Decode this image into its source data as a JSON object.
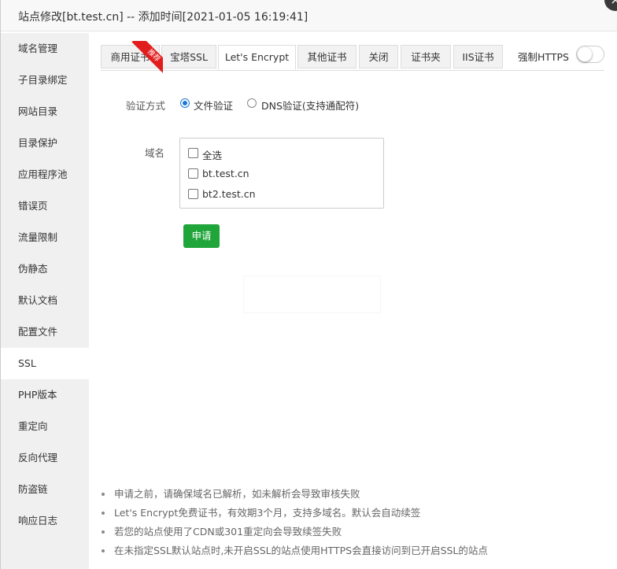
{
  "dialog": {
    "title": "站点修改[bt.test.cn] -- 添加时间[2021-01-05 16:19:41]",
    "close_icon": "close-icon",
    "close_glyph": "×"
  },
  "sidebar": {
    "items": [
      {
        "label": "域名管理"
      },
      {
        "label": "子目录绑定"
      },
      {
        "label": "网站目录"
      },
      {
        "label": "目录保护"
      },
      {
        "label": "应用程序池"
      },
      {
        "label": "错误页"
      },
      {
        "label": "流量限制"
      },
      {
        "label": "伪静态"
      },
      {
        "label": "默认文档"
      },
      {
        "label": "配置文件"
      },
      {
        "label": "SSL",
        "active": true
      },
      {
        "label": "PHP版本"
      },
      {
        "label": "重定向"
      },
      {
        "label": "反向代理"
      },
      {
        "label": "防盗链"
      },
      {
        "label": "响应日志"
      }
    ]
  },
  "tabs": {
    "items": [
      {
        "label": "商用证书"
      },
      {
        "label": "宝塔SSL"
      },
      {
        "label": "Let's Encrypt",
        "active": true
      },
      {
        "label": "其他证书"
      },
      {
        "label": "关闭"
      },
      {
        "label": "证书夹"
      },
      {
        "label": "IIS证书"
      }
    ],
    "ribbon_label": "推荐",
    "ribbon_color": "#e21d1d"
  },
  "force_https": {
    "label": "强制HTTPS",
    "enabled": false
  },
  "form": {
    "verify_label": "验证方式",
    "verify_options": [
      {
        "label": "文件验证",
        "checked": true
      },
      {
        "label": "DNS验证(支持通配符)",
        "checked": false
      }
    ],
    "domain_label": "域名",
    "domains": [
      {
        "label": "全选",
        "checked": false
      },
      {
        "label": "bt.test.cn",
        "checked": false
      },
      {
        "label": "bt2.test.cn",
        "checked": false
      }
    ],
    "apply_label": "申请",
    "apply_color": "#20a53a"
  },
  "notes": [
    "申请之前，请确保域名已解析，如未解析会导致审核失败",
    "Let's Encrypt免费证书，有效期3个月，支持多域名。默认会自动续签",
    "若您的站点使用了CDN或301重定向会导致续签失败",
    "在未指定SSL默认站点时,未开启SSL的站点使用HTTPS会直接访问到已开启SSL的站点"
  ],
  "colors": {
    "accent_blue": "#1b78d6",
    "sidebar_bg": "#f0f0f0"
  }
}
